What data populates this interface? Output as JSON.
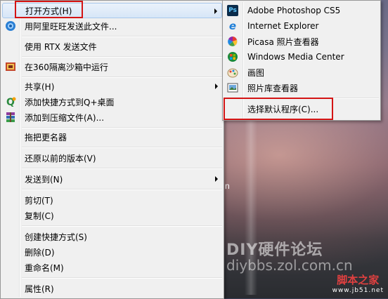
{
  "main_menu": {
    "items": [
      {
        "label": "打开方式(H)",
        "icon": "none",
        "submenu": true
      },
      {
        "label": "用阿里旺旺发送此文件...",
        "icon": "aliwangwang-icon"
      },
      {
        "label": "使用 RTX 发送文件",
        "icon": "none"
      },
      {
        "label": "在360隔离沙箱中运行",
        "icon": "sandbox-360-icon"
      },
      {
        "label": "共享(H)",
        "icon": "none",
        "submenu": true
      },
      {
        "label": "添加快捷方式到Q+桌面",
        "icon": "qplus-icon"
      },
      {
        "label": "添加到压缩文件(A)...",
        "icon": "winrar-icon"
      },
      {
        "label": "拖把更名器",
        "icon": "none"
      },
      {
        "label": "还原以前的版本(V)",
        "icon": "none"
      },
      {
        "label": "发送到(N)",
        "icon": "none",
        "submenu": true
      },
      {
        "label": "剪切(T)",
        "icon": "none"
      },
      {
        "label": "复制(C)",
        "icon": "none"
      },
      {
        "label": "创建快捷方式(S)",
        "icon": "none"
      },
      {
        "label": "删除(D)",
        "icon": "none"
      },
      {
        "label": "重命名(M)",
        "icon": "none"
      },
      {
        "label": "属性(R)",
        "icon": "none"
      }
    ]
  },
  "open_with_submenu": {
    "items": [
      {
        "label": "Adobe Photoshop CS5",
        "icon": "photoshop-icon"
      },
      {
        "label": "Internet Explorer",
        "icon": "internet-explorer-icon"
      },
      {
        "label": "Picasa 照片查看器",
        "icon": "picasa-icon"
      },
      {
        "label": "Windows Media Center",
        "icon": "windows-media-center-icon"
      },
      {
        "label": "画图",
        "icon": "paint-icon"
      },
      {
        "label": "照片库查看器",
        "icon": "photo-gallery-icon"
      },
      {
        "label": "选择默认程序(C)...",
        "icon": "none"
      }
    ]
  },
  "glyphs": {
    "ps": "Ps",
    "ie": "e",
    "q": "Q"
  },
  "desktop": {
    "stray_letter": "n",
    "watermark_title": "DIY硬件论坛",
    "watermark_url": "diybbs.zol.com.cn",
    "site_logo": "脚本之家",
    "site_logo_url": "www.jb51.net"
  },
  "colors": {
    "menu_bg": "#f0f0f0",
    "highlight_box": "#d41414",
    "hover_bg": "#d7e6f7"
  }
}
